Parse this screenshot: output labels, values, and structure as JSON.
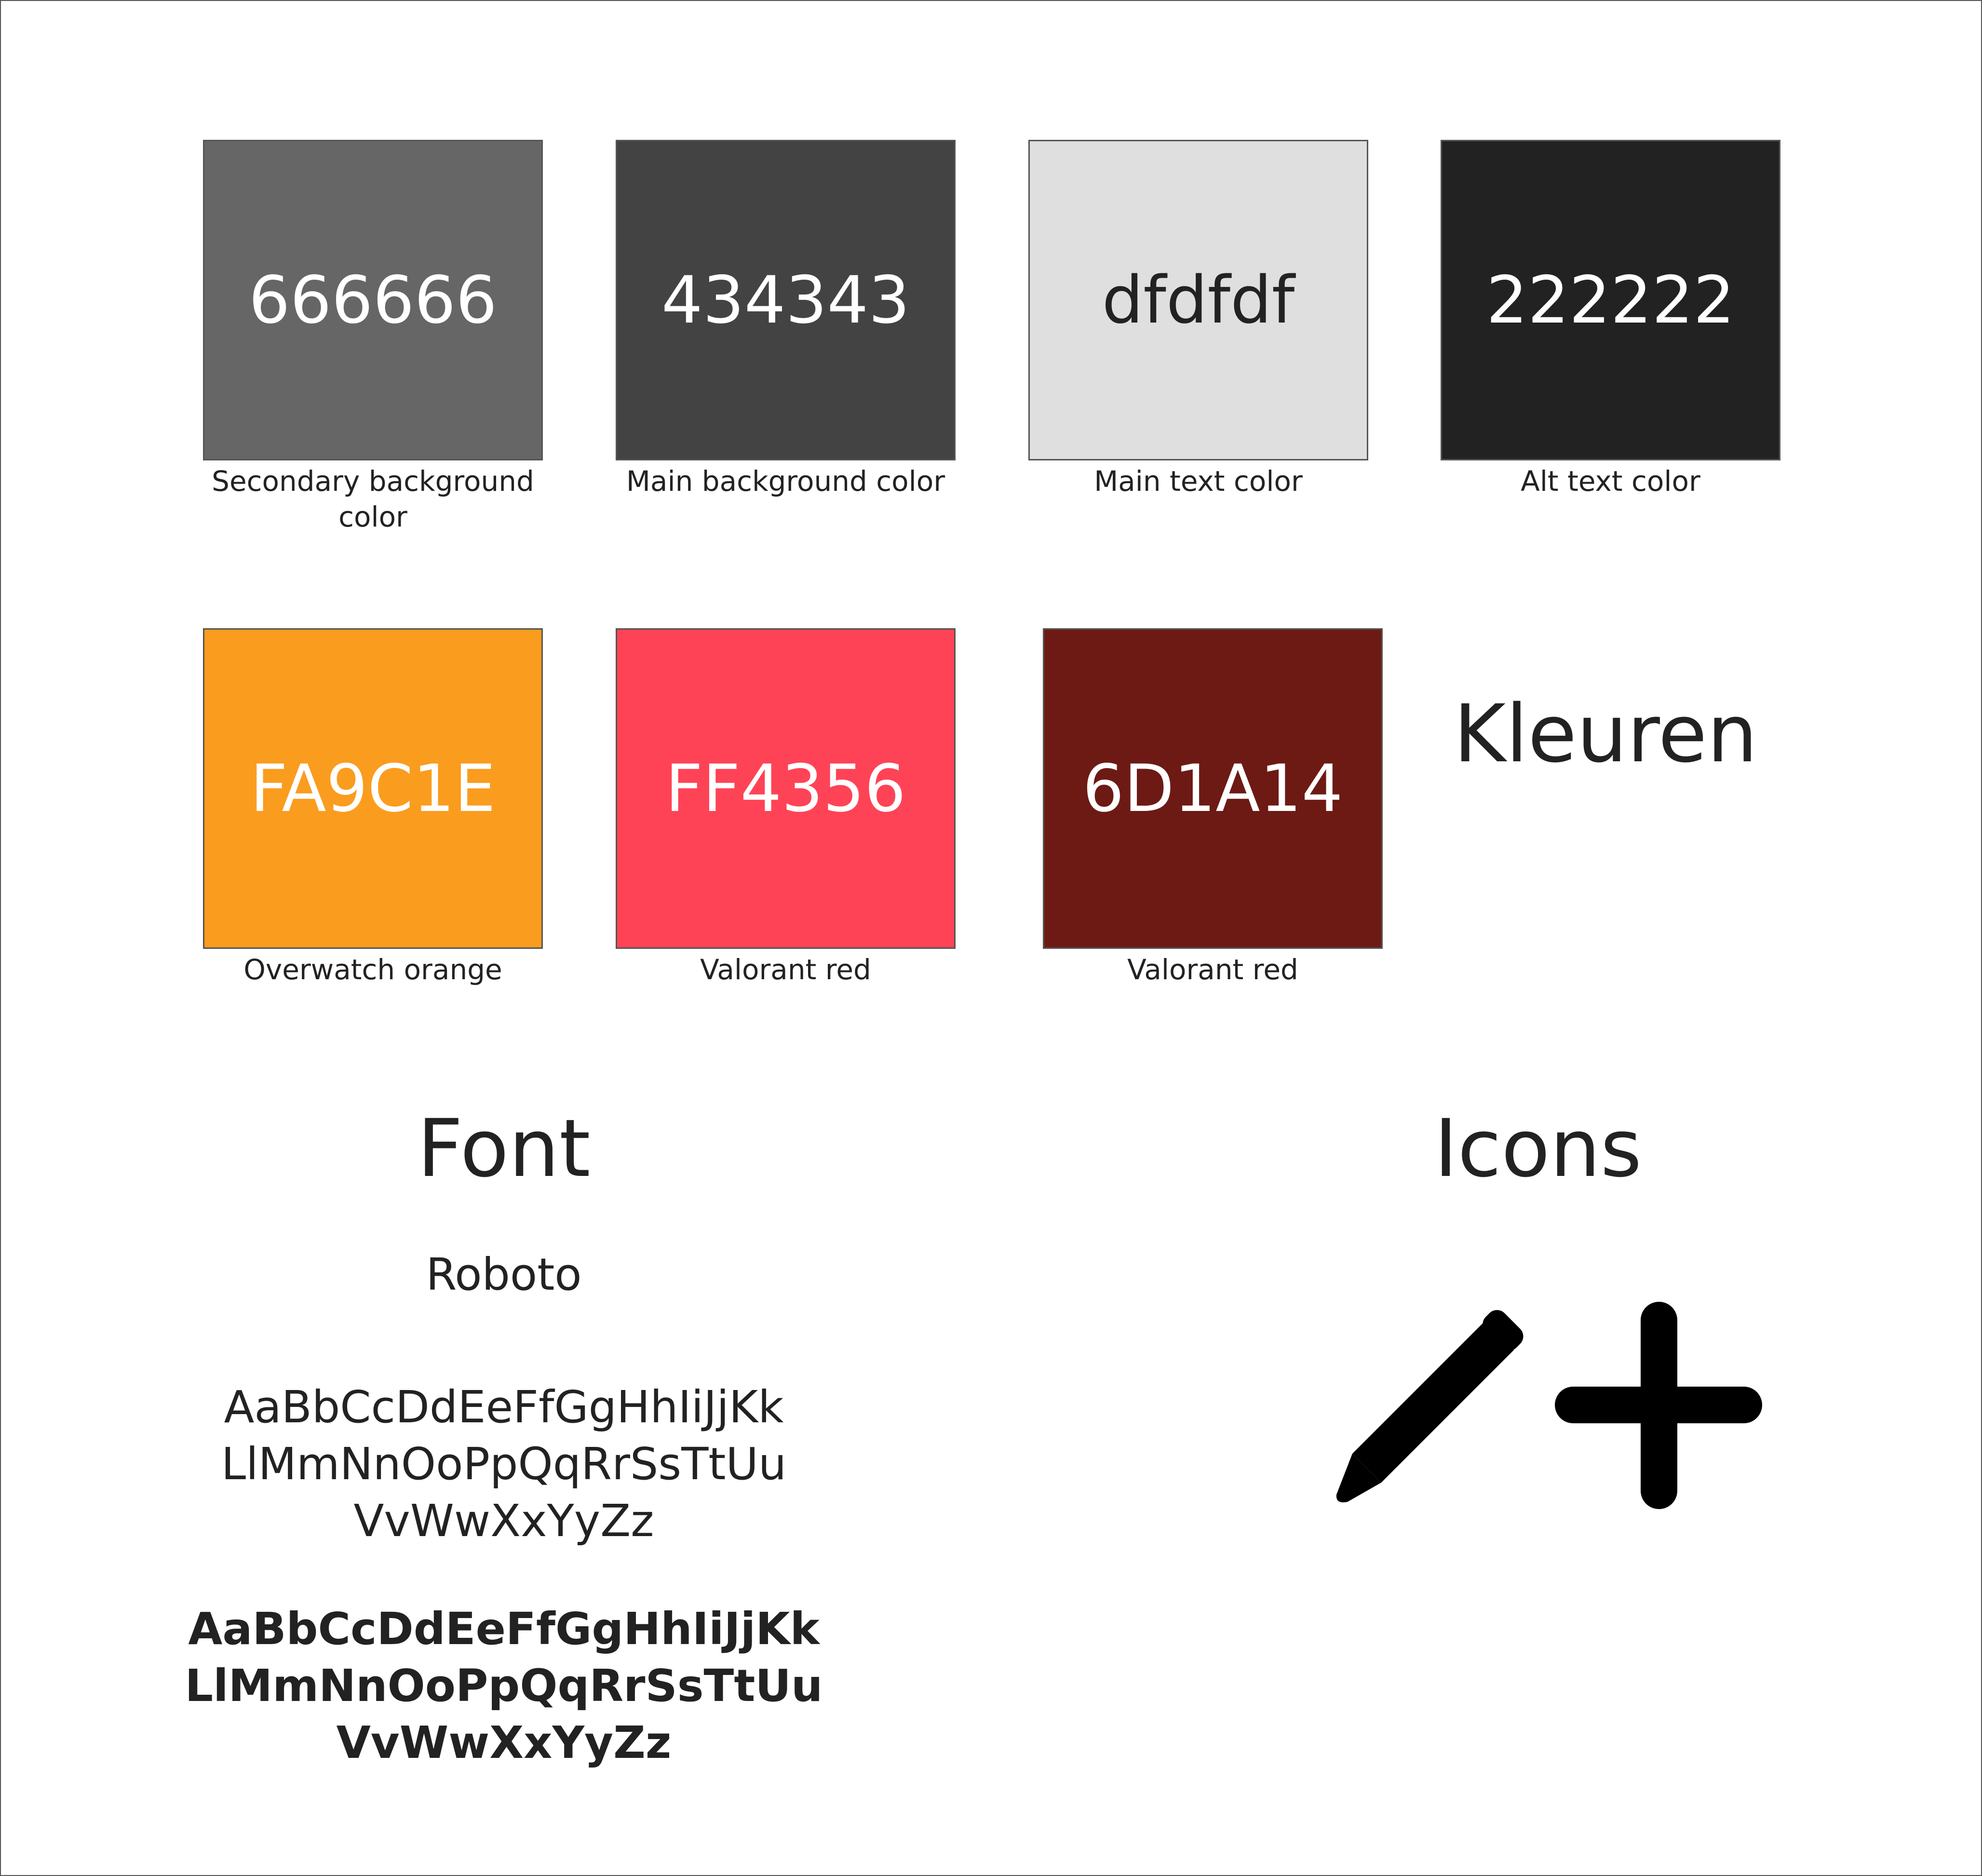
{
  "section_title": "Kleuren",
  "colors": {
    "row1": [
      {
        "hex": "666666",
        "label": "Secondary background color",
        "swatch_color": "#666666",
        "text_color": "#ffffff"
      },
      {
        "hex": "434343",
        "label": "Main background color",
        "swatch_color": "#434343",
        "text_color": "#ffffff"
      },
      {
        "hex": "dfdfdf",
        "label": "Main text color",
        "swatch_color": "#dfdfdf",
        "text_color": "#222222"
      },
      {
        "hex": "222222",
        "label": "Alt text color",
        "swatch_color": "#222222",
        "text_color": "#ffffff"
      }
    ],
    "row2": [
      {
        "hex": "FA9C1E",
        "label": "Overwatch orange",
        "swatch_color": "#FA9C1E",
        "text_color": "#ffffff"
      },
      {
        "hex": "FF4356",
        "label": "Valorant red",
        "swatch_color": "#FF4356",
        "text_color": "#ffffff"
      },
      {
        "hex": "6D1A14",
        "label": "Valorant red",
        "swatch_color": "#6D1A14",
        "text_color": "#ffffff"
      }
    ]
  },
  "font": {
    "heading": "Font",
    "name": "Roboto",
    "regular_lines": [
      "AaBbCcDdEeFfGgHhIiJjKk",
      "LlMmNnOoPpQqRrSsTtUu",
      "VvWwXxYyZz"
    ],
    "bold_lines": [
      "AaBbCcDdEeFfGgHhIiJjKk",
      "LlMmNnOoPpQqRrSsTtUu",
      "VvWwXxYyZz"
    ]
  },
  "icons": {
    "heading": "Icons",
    "items": [
      "pencil-icon",
      "plus-icon"
    ]
  }
}
